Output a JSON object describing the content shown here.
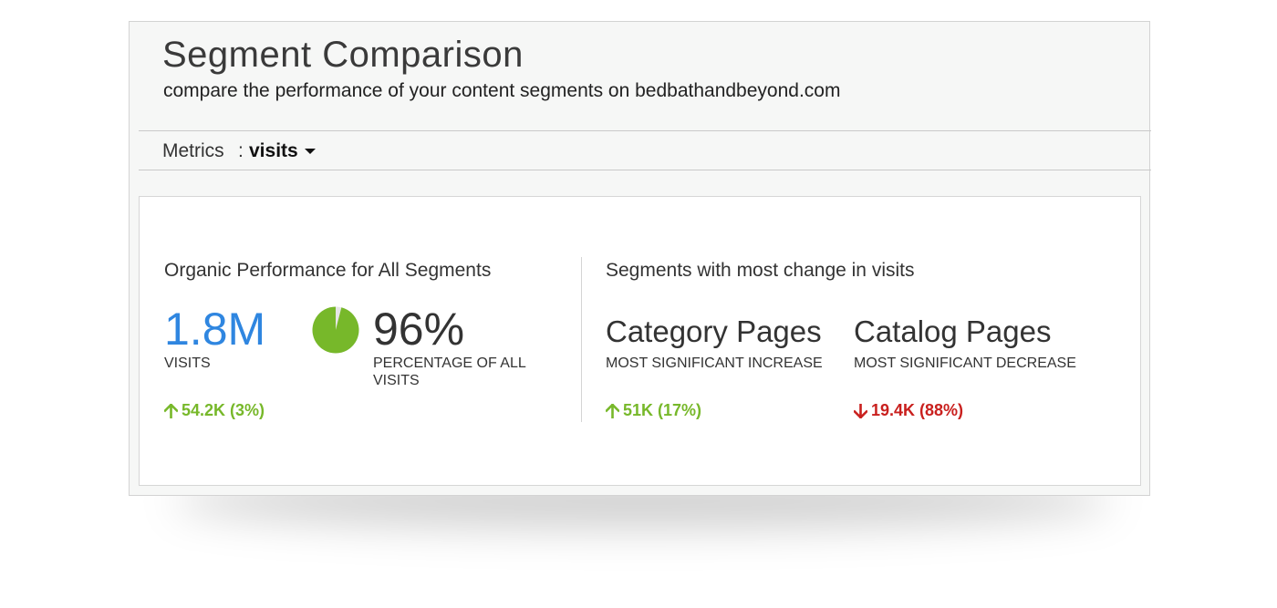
{
  "header": {
    "title": "Segment Comparison",
    "subtitle": "compare the performance of your content segments on bedbathandbeyond.com"
  },
  "metrics": {
    "label": "Metrics",
    "separator": ":",
    "selected": "visits",
    "icon": "caret-down-icon"
  },
  "overall": {
    "heading": "Organic Performance for All Segments",
    "visits_value": "1.8M",
    "visits_label": "VISITS",
    "visits_delta": "54.2K (3%)",
    "visits_delta_direction": "up",
    "percentage_value": "96%",
    "percentage_fraction": 0.96,
    "percentage_label": "PERCENTAGE OF ALL VISITS"
  },
  "changes": {
    "heading": "Segments with most change in visits",
    "increase": {
      "name": "Category Pages",
      "label": "MOST SIGNIFICANT INCREASE",
      "delta": "51K (17%)",
      "direction": "up"
    },
    "decrease": {
      "name": "Catalog Pages",
      "label": "MOST SIGNIFICANT DECREASE",
      "delta": "19.4K (88%)",
      "direction": "down"
    }
  },
  "colors": {
    "blue": "#2f86e0",
    "green": "#77b82a",
    "red": "#c9201e",
    "pie_remainder": "#e6e6e6"
  }
}
